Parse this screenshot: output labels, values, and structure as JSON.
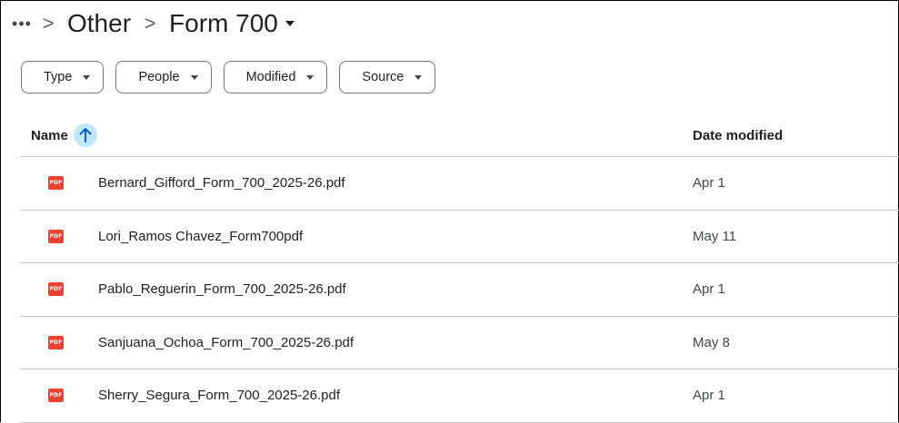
{
  "breadcrumb": {
    "more_label": "•••",
    "separator": ">",
    "parent": "Other",
    "current": "Form 700"
  },
  "filters": [
    {
      "label": "Type"
    },
    {
      "label": "People"
    },
    {
      "label": "Modified"
    },
    {
      "label": "Source"
    }
  ],
  "table": {
    "columns": {
      "name": "Name",
      "date_modified": "Date modified"
    },
    "sort": {
      "column": "name",
      "direction": "ascending"
    },
    "files": [
      {
        "name": "Bernard_Gifford_Form_700_2025-26.pdf",
        "date": "Apr 1",
        "icon": "pdf-icon"
      },
      {
        "name": "Lori_Ramos Chavez_Form700pdf",
        "date": "May 11",
        "icon": "pdf-icon"
      },
      {
        "name": "Pablo_Reguerin_Form_700_2025-26.pdf",
        "date": "Apr 1",
        "icon": "pdf-icon"
      },
      {
        "name": "Sanjuana_Ochoa_Form_700_2025-26.pdf",
        "date": "May 8",
        "icon": "pdf-icon"
      },
      {
        "name": "Sherry_Segura_Form_700_2025-26.pdf",
        "date": "Apr 1",
        "icon": "pdf-icon"
      }
    ]
  },
  "icons": {
    "pdf_label": "PDF"
  },
  "colors": {
    "pdf_red": "#ea4335",
    "sort_highlight": "#c2e7ff",
    "sort_arrow": "#0b57d0"
  }
}
